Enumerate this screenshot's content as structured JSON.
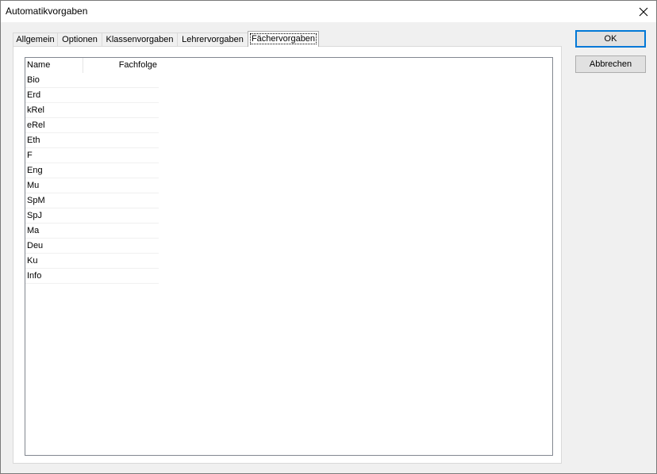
{
  "window": {
    "title": "Automatikvorgaben"
  },
  "tabs": [
    {
      "label": "Allgemein"
    },
    {
      "label": "Optionen"
    },
    {
      "label": "Klassenvorgaben"
    },
    {
      "label": "Lehrervorgaben"
    },
    {
      "label": "Fächervorgaben",
      "active": true
    }
  ],
  "list": {
    "columns": {
      "name": "Name",
      "fachfolge": "Fachfolge"
    },
    "rows": [
      {
        "name": "Bio",
        "fachfolge": ""
      },
      {
        "name": "Erd",
        "fachfolge": ""
      },
      {
        "name": "kRel",
        "fachfolge": ""
      },
      {
        "name": "eRel",
        "fachfolge": ""
      },
      {
        "name": "Eth",
        "fachfolge": ""
      },
      {
        "name": "F",
        "fachfolge": ""
      },
      {
        "name": "Eng",
        "fachfolge": ""
      },
      {
        "name": "Mu",
        "fachfolge": ""
      },
      {
        "name": "SpM",
        "fachfolge": ""
      },
      {
        "name": "SpJ",
        "fachfolge": ""
      },
      {
        "name": "Ma",
        "fachfolge": ""
      },
      {
        "name": "Deu",
        "fachfolge": ""
      },
      {
        "name": "Ku",
        "fachfolge": ""
      },
      {
        "name": "Info",
        "fachfolge": ""
      }
    ]
  },
  "buttons": {
    "ok": "OK",
    "cancel": "Abbrechen"
  },
  "icons": {
    "close": "close-icon"
  },
  "colors": {
    "accent": "#0078d7",
    "window_bg": "#f0f0f0"
  }
}
